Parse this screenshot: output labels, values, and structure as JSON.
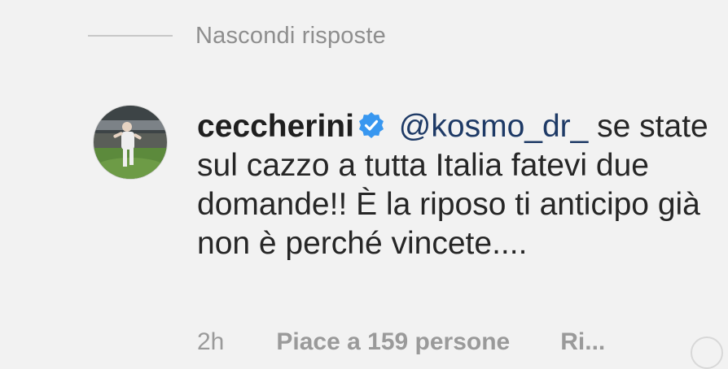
{
  "thread": {
    "hide_replies_label": "Nascondi risposte"
  },
  "comment": {
    "username": "ceccherini",
    "verified": true,
    "mention": "@kosmo_dr_",
    "text": "se state sul cazzo a tutta Italia fatevi due domande!! È la riposo ti anticipo già non è perché vincete....",
    "time": "2h",
    "likes_label": "Piace a 159 persone",
    "reply_label": "Ri..."
  },
  "colors": {
    "verified_badge": "#3897f0",
    "mention": "#1e3a66",
    "secondary_text": "#8e8e8e"
  }
}
